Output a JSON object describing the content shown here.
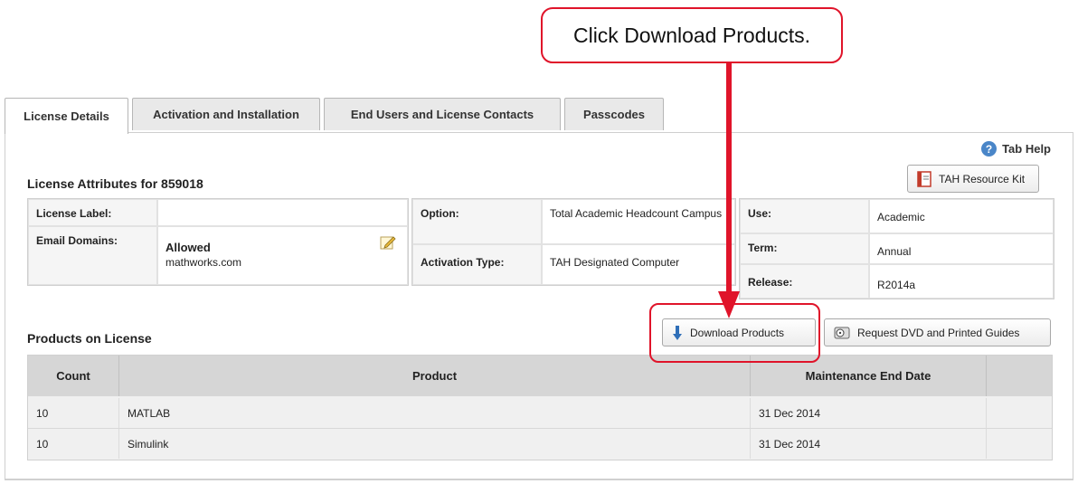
{
  "callout": {
    "text": "Click Download Products."
  },
  "tabs": [
    {
      "label": "License Details",
      "active": true
    },
    {
      "label": "Activation and Installation",
      "active": false
    },
    {
      "label": "End Users and License Contacts",
      "active": false
    },
    {
      "label": "Passcodes",
      "active": false
    }
  ],
  "tab_help": {
    "label": "Tab Help",
    "icon": "help-icon"
  },
  "license": {
    "title": "License Attributes for 859018",
    "resource_kit_label": "TAH Resource Kit",
    "label_field": {
      "label": "License Label:",
      "value": ""
    },
    "email_domains": {
      "label": "Email Domains:",
      "status": "Allowed",
      "domain": "mathworks.com",
      "edit_icon": "edit-icon"
    },
    "option": {
      "label": "Option:",
      "value": "Total Academic Headcount Campus"
    },
    "activation_type": {
      "label": "Activation Type:",
      "value": "TAH Designated Computer"
    },
    "use": {
      "label": "Use:",
      "value": "Academic"
    },
    "term": {
      "label": "Term:",
      "value": "Annual"
    },
    "release": {
      "label": "Release:",
      "value": "R2014a"
    }
  },
  "products": {
    "title": "Products on License",
    "download_label": "Download Products",
    "request_label": "Request DVD and Printed Guides",
    "columns": [
      "Count",
      "Product",
      "Maintenance End Date"
    ],
    "rows": [
      {
        "count": "10",
        "product": "MATLAB",
        "date": "31 Dec 2014"
      },
      {
        "count": "10",
        "product": "Simulink",
        "date": "31 Dec 2014"
      }
    ]
  },
  "colors": {
    "annotation_red": "#e0142a",
    "header_gray": "#d6d6d6",
    "help_blue": "#4a86c8"
  }
}
